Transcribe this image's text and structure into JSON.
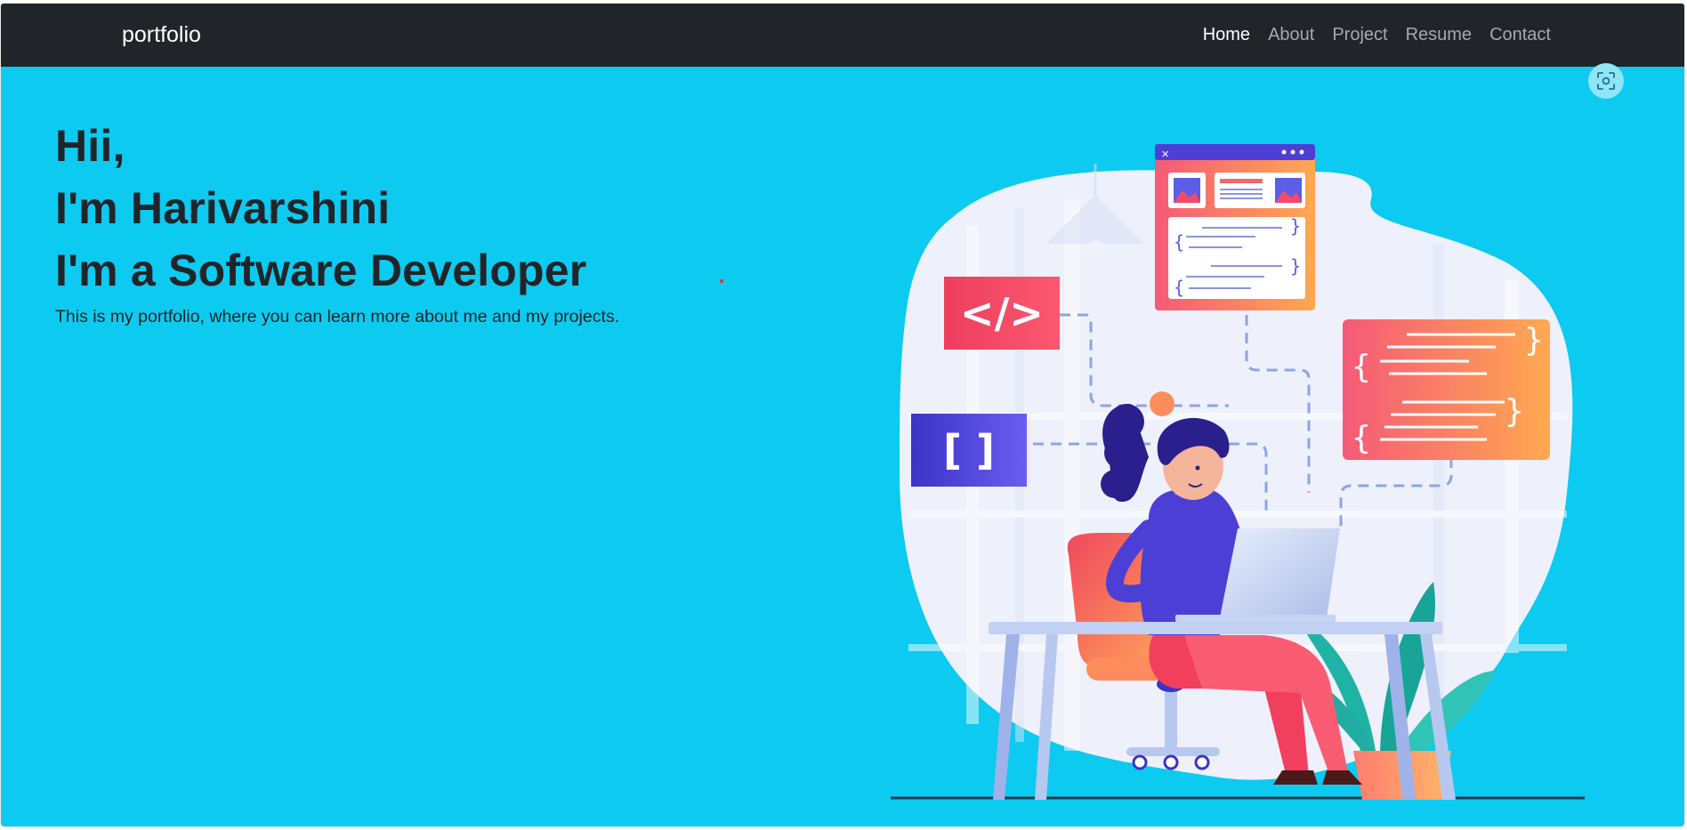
{
  "navbar": {
    "brand": "portfolio",
    "links": [
      {
        "label": "Home",
        "active": true
      },
      {
        "label": "About",
        "active": false
      },
      {
        "label": "Project",
        "active": false
      },
      {
        "label": "Resume",
        "active": false
      },
      {
        "label": "Contact",
        "active": false
      }
    ]
  },
  "hero": {
    "greeting": "Hii,",
    "name_line": "I'm Harivarshini",
    "role_line": "I'm a Software Developer",
    "description": "This is my portfolio, where you can learn more about me and my projects."
  },
  "illustration": {
    "code_tag_badge": "</>",
    "brackets_badge": "[ ]"
  },
  "screenshot_button": {
    "icon": "screenshot-scan-icon"
  },
  "colors": {
    "navbar_bg": "#212529",
    "hero_bg": "#0dcaf0",
    "text_dark": "#212529"
  }
}
